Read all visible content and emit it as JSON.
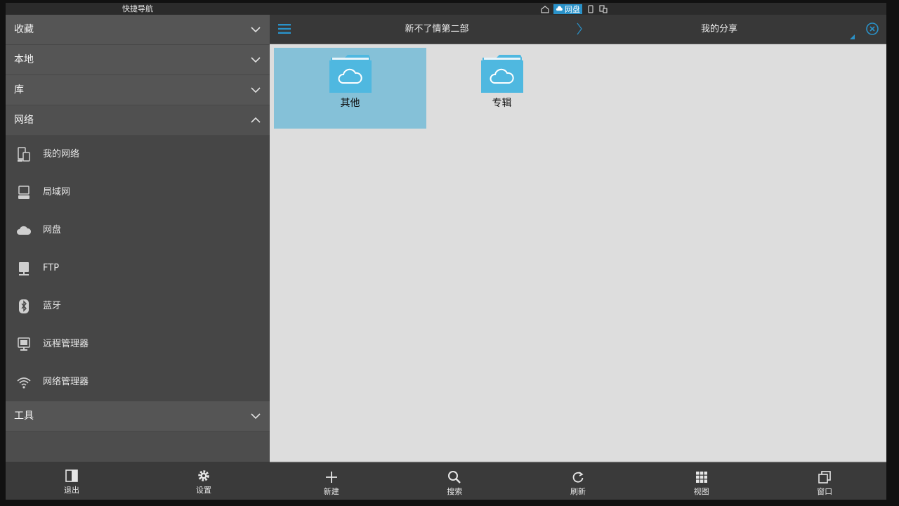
{
  "sidebar": {
    "title": "快捷导航",
    "sections": {
      "favorites": "收藏",
      "local": "本地",
      "library": "库",
      "network": "网络",
      "tools": "工具"
    },
    "network_items": [
      {
        "label": "我的网络",
        "icon": "my-network-icon"
      },
      {
        "label": "局域网",
        "icon": "lan-icon"
      },
      {
        "label": "网盘",
        "icon": "cloud-icon"
      },
      {
        "label": "FTP",
        "icon": "ftp-icon"
      },
      {
        "label": "蓝牙",
        "icon": "bluetooth-icon"
      },
      {
        "label": "远程管理器",
        "icon": "remote-manager-icon"
      },
      {
        "label": "网络管理器",
        "icon": "wifi-icon"
      }
    ],
    "bottom": {
      "exit_label": "退出",
      "settings_label": "设置"
    }
  },
  "status": {
    "active_label": "网盘"
  },
  "header": {
    "path_tab": "新不了情第二部",
    "share_tab": "我的分享"
  },
  "files": [
    {
      "name": "其他",
      "selected": true
    },
    {
      "name": "专辑",
      "selected": false
    }
  ],
  "toolbar": {
    "new_label": "新建",
    "search_label": "搜索",
    "refresh_label": "刷新",
    "view_label": "视图",
    "window_label": "窗口"
  },
  "colors": {
    "accent": "#2a92c9",
    "selection": "#85c1d8",
    "folder": "#4fb8e0"
  }
}
